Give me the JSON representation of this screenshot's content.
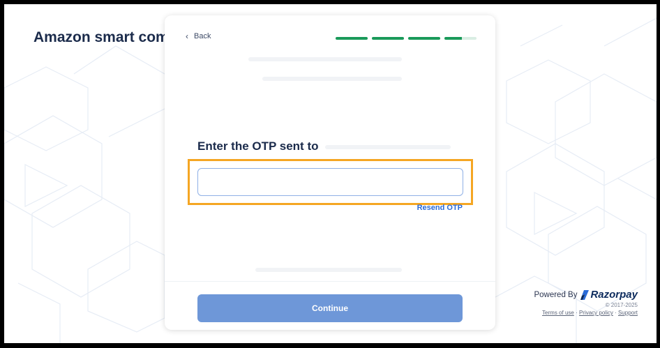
{
  "merchant": {
    "title": "Amazon smart comm"
  },
  "nav": {
    "back_label": "Back"
  },
  "progress": {
    "steps": [
      1,
      1,
      1,
      0.55
    ]
  },
  "otp": {
    "heading": "Enter the OTP sent to",
    "input_value": "",
    "input_placeholder": "",
    "resend_label": "Resend OTP"
  },
  "actions": {
    "continue_label": "Continue"
  },
  "footer": {
    "powered_by": "Powered By",
    "brand": "Razorpay",
    "copyright": "© 2017-2025",
    "links": {
      "terms": "Terms of use",
      "privacy": "Privacy policy",
      "support": "Support"
    }
  },
  "colors": {
    "accent": "#2a6bd8",
    "progress": "#1a9a5a",
    "button": "#6e97d8",
    "highlight": "#f5a623",
    "brand": "#0b2a5c"
  },
  "icons": {
    "back": "chevron-left-icon",
    "brand": "razorpay-logo-icon"
  }
}
